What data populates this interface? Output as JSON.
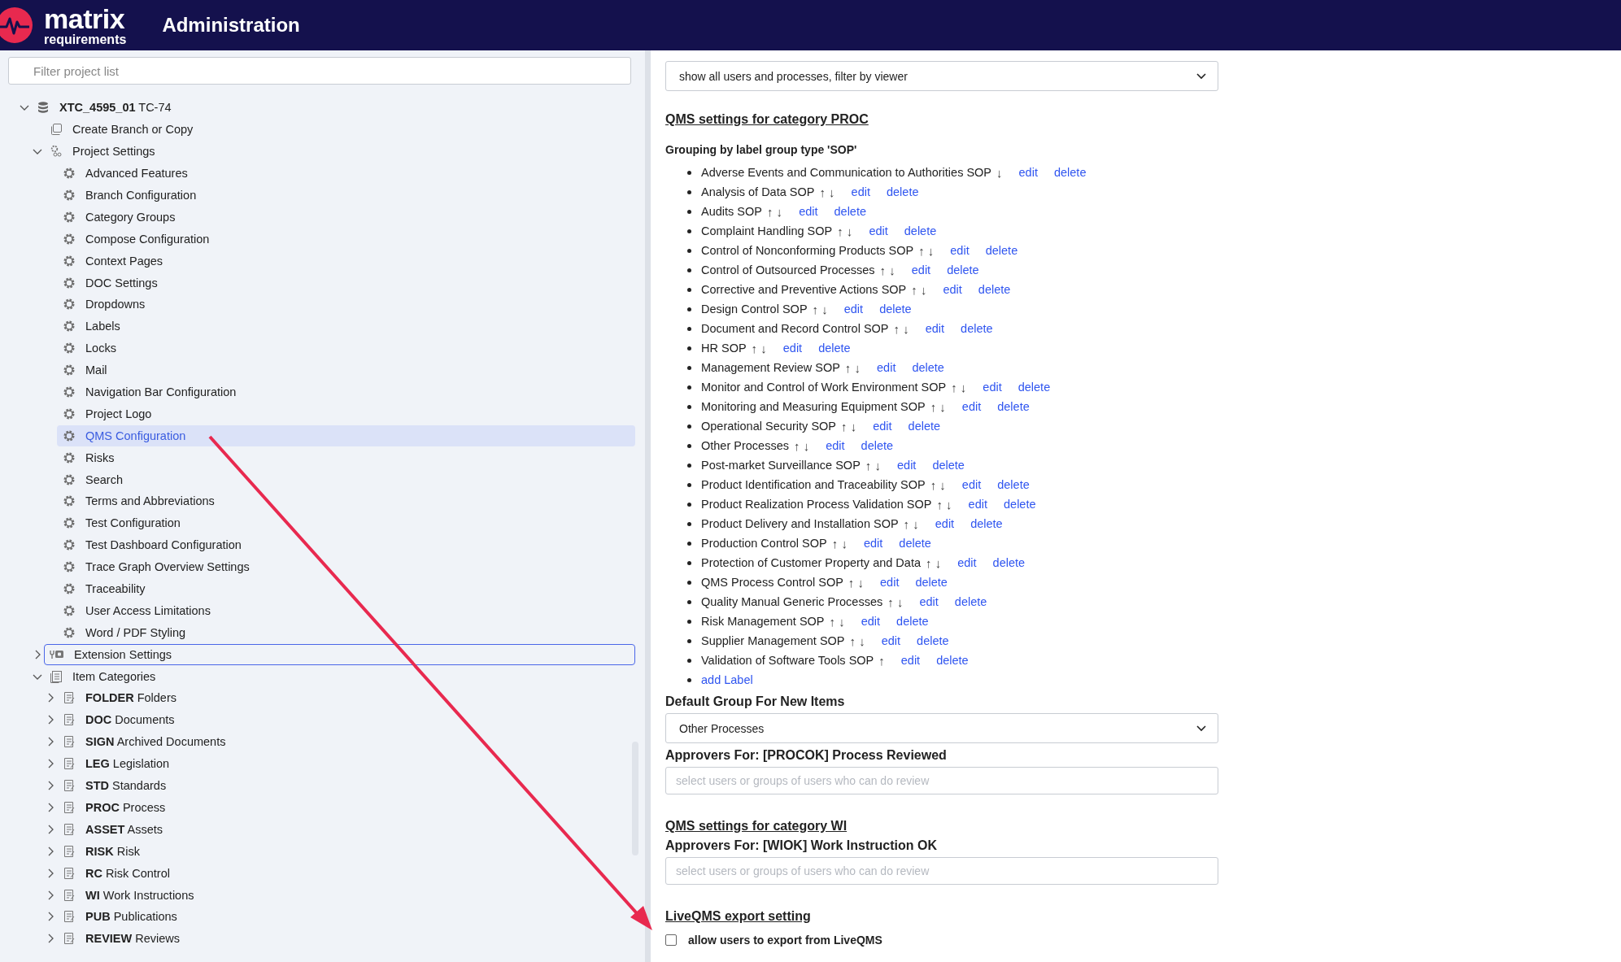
{
  "header": {
    "logo_word": "matrix",
    "logo_sub": "requirements",
    "title": "Administration"
  },
  "sidebar": {
    "filter": {
      "placeholder": "Filter project list"
    },
    "tree": [
      {
        "kind": "project",
        "code": "XTC_4595_01",
        "label": "TC-74",
        "expanded": true,
        "selected": false,
        "focused": false,
        "children": [
          {
            "kind": "copy",
            "label": "Create Branch or Copy",
            "selected": false,
            "focused": false
          },
          {
            "kind": "settings",
            "label": "Project Settings",
            "expanded": true,
            "selected": false,
            "focused": false,
            "children": [
              {
                "kind": "gear",
                "label": "Advanced Features",
                "selected": false,
                "focused": false
              },
              {
                "kind": "gear",
                "label": "Branch Configuration",
                "selected": false,
                "focused": false
              },
              {
                "kind": "gear",
                "label": "Category Groups",
                "selected": false,
                "focused": false
              },
              {
                "kind": "gear",
                "label": "Compose Configuration",
                "selected": false,
                "focused": false
              },
              {
                "kind": "gear",
                "label": "Context Pages",
                "selected": false,
                "focused": false
              },
              {
                "kind": "gear",
                "label": "DOC Settings",
                "selected": false,
                "focused": false
              },
              {
                "kind": "gear",
                "label": "Dropdowns",
                "selected": false,
                "focused": false
              },
              {
                "kind": "gear",
                "label": "Labels",
                "selected": false,
                "focused": false
              },
              {
                "kind": "gear",
                "label": "Locks",
                "selected": false,
                "focused": false
              },
              {
                "kind": "gear",
                "label": "Mail",
                "selected": false,
                "focused": false
              },
              {
                "kind": "gear",
                "label": "Navigation Bar Configuration",
                "selected": false,
                "focused": false
              },
              {
                "kind": "gear",
                "label": "Project Logo",
                "selected": false,
                "focused": false
              },
              {
                "kind": "gear",
                "label": "QMS Configuration",
                "selected": true,
                "focused": false
              },
              {
                "kind": "gear",
                "label": "Risks",
                "selected": false,
                "focused": false
              },
              {
                "kind": "gear",
                "label": "Search",
                "selected": false,
                "focused": false
              },
              {
                "kind": "gear",
                "label": "Terms and Abbreviations",
                "selected": false,
                "focused": false
              },
              {
                "kind": "gear",
                "label": "Test Configuration",
                "selected": false,
                "focused": false
              },
              {
                "kind": "gear",
                "label": "Test Dashboard Configuration",
                "selected": false,
                "focused": false
              },
              {
                "kind": "gear",
                "label": "Trace Graph Overview Settings",
                "selected": false,
                "focused": false
              },
              {
                "kind": "gear",
                "label": "Traceability",
                "selected": false,
                "focused": false
              },
              {
                "kind": "gear",
                "label": "User Access Limitations",
                "selected": false,
                "focused": false
              },
              {
                "kind": "gear",
                "label": "Word / PDF Styling",
                "selected": false,
                "focused": false
              }
            ]
          },
          {
            "kind": "extension",
            "label": "Extension Settings",
            "expanded": false,
            "selected": false,
            "focused": true
          },
          {
            "kind": "list",
            "label": "Item Categories",
            "expanded": true,
            "selected": false,
            "focused": false,
            "children": [
              {
                "kind": "category",
                "code": "FOLDER",
                "label": "Folders",
                "expanded": false,
                "selected": false,
                "focused": false
              },
              {
                "kind": "category",
                "code": "DOC",
                "label": "Documents",
                "expanded": false,
                "selected": false,
                "focused": false
              },
              {
                "kind": "category",
                "code": "SIGN",
                "label": "Archived Documents",
                "expanded": false,
                "selected": false,
                "focused": false
              },
              {
                "kind": "category",
                "code": "LEG",
                "label": "Legislation",
                "expanded": false,
                "selected": false,
                "focused": false
              },
              {
                "kind": "category",
                "code": "STD",
                "label": "Standards",
                "expanded": false,
                "selected": false,
                "focused": false
              },
              {
                "kind": "category",
                "code": "PROC",
                "label": "Process",
                "expanded": false,
                "selected": false,
                "focused": false
              },
              {
                "kind": "category",
                "code": "ASSET",
                "label": "Assets",
                "expanded": false,
                "selected": false,
                "focused": false
              },
              {
                "kind": "category",
                "code": "RISK",
                "label": "Risk",
                "expanded": false,
                "selected": false,
                "focused": false
              },
              {
                "kind": "category",
                "code": "RC",
                "label": "Risk Control",
                "expanded": false,
                "selected": false,
                "focused": false
              },
              {
                "kind": "category",
                "code": "WI",
                "label": "Work Instructions",
                "expanded": false,
                "selected": false,
                "focused": false
              },
              {
                "kind": "category",
                "code": "PUB",
                "label": "Publications",
                "expanded": false,
                "selected": false,
                "focused": false
              },
              {
                "kind": "category",
                "code": "REVIEW",
                "label": "Reviews",
                "expanded": false,
                "selected": false,
                "focused": false
              }
            ]
          }
        ]
      }
    ]
  },
  "main": {
    "publication_select": {
      "value": "show all users and processes, filter by viewer"
    },
    "proc": {
      "heading": "QMS settings for category PROC",
      "grouping": "Grouping by label group type 'SOP'",
      "labels": [
        {
          "name": "Adverse Events and Communication to Authorities SOP",
          "arrows": "↓",
          "edit": "edit",
          "delete": "delete"
        },
        {
          "name": "Analysis of Data SOP",
          "arrows": "↑ ↓",
          "edit": "edit",
          "delete": "delete"
        },
        {
          "name": "Audits SOP",
          "arrows": "↑ ↓",
          "edit": "edit",
          "delete": "delete"
        },
        {
          "name": "Complaint Handling SOP",
          "arrows": "↑ ↓",
          "edit": "edit",
          "delete": "delete"
        },
        {
          "name": "Control of Nonconforming Products SOP",
          "arrows": "↑ ↓",
          "edit": "edit",
          "delete": "delete"
        },
        {
          "name": "Control of Outsourced Processes",
          "arrows": "↑ ↓",
          "edit": "edit",
          "delete": "delete"
        },
        {
          "name": "Corrective and Preventive Actions SOP",
          "arrows": "↑ ↓",
          "edit": "edit",
          "delete": "delete"
        },
        {
          "name": "Design Control SOP",
          "arrows": "↑ ↓",
          "edit": "edit",
          "delete": "delete"
        },
        {
          "name": "Document and Record Control SOP",
          "arrows": "↑ ↓",
          "edit": "edit",
          "delete": "delete"
        },
        {
          "name": "HR SOP",
          "arrows": "↑ ↓",
          "edit": "edit",
          "delete": "delete"
        },
        {
          "name": "Management Review SOP",
          "arrows": "↑ ↓",
          "edit": "edit",
          "delete": "delete"
        },
        {
          "name": "Monitor and Control of Work Environment SOP",
          "arrows": "↑ ↓",
          "edit": "edit",
          "delete": "delete"
        },
        {
          "name": "Monitoring and Measuring Equipment SOP",
          "arrows": "↑ ↓",
          "edit": "edit",
          "delete": "delete"
        },
        {
          "name": "Operational Security SOP",
          "arrows": "↑ ↓",
          "edit": "edit",
          "delete": "delete"
        },
        {
          "name": "Other Processes",
          "arrows": "↑ ↓",
          "edit": "edit",
          "delete": "delete"
        },
        {
          "name": "Post-market Surveillance SOP",
          "arrows": "↑ ↓",
          "edit": "edit",
          "delete": "delete"
        },
        {
          "name": "Product Identification and Traceability SOP",
          "arrows": "↑ ↓",
          "edit": "edit",
          "delete": "delete"
        },
        {
          "name": "Product Realization Process Validation SOP",
          "arrows": "↑ ↓",
          "edit": "edit",
          "delete": "delete"
        },
        {
          "name": "Product Delivery and Installation SOP",
          "arrows": "↑ ↓",
          "edit": "edit",
          "delete": "delete"
        },
        {
          "name": "Production Control SOP",
          "arrows": "↑ ↓",
          "edit": "edit",
          "delete": "delete"
        },
        {
          "name": "Protection of Customer Property and Data",
          "arrows": "↑ ↓",
          "edit": "edit",
          "delete": "delete"
        },
        {
          "name": "QMS Process Control SOP",
          "arrows": "↑ ↓",
          "edit": "edit",
          "delete": "delete"
        },
        {
          "name": "Quality Manual Generic Processes",
          "arrows": "↑ ↓",
          "edit": "edit",
          "delete": "delete"
        },
        {
          "name": "Risk Management SOP",
          "arrows": "↑ ↓",
          "edit": "edit",
          "delete": "delete"
        },
        {
          "name": "Supplier Management SOP",
          "arrows": "↑ ↓",
          "edit": "edit",
          "delete": "delete"
        },
        {
          "name": "Validation of Software Tools SOP",
          "arrows": "↑",
          "edit": "edit",
          "delete": "delete"
        }
      ],
      "add_label": "add Label",
      "default_group": {
        "label": "Default Group For New Items",
        "value": "Other Processes"
      },
      "approvers": {
        "label": "Approvers For: [PROCOK] Process Reviewed",
        "placeholder": "select users or groups of users who can do review"
      }
    },
    "wi": {
      "heading": "QMS settings for category WI",
      "approvers": {
        "label": "Approvers For: [WIOK] Work Instruction OK",
        "placeholder": "select users or groups of users who can do review"
      }
    },
    "liveqms": {
      "heading": "LiveQMS export setting",
      "checkbox": {
        "label": "allow users to export from LiveQMS",
        "checked": false
      }
    }
  }
}
